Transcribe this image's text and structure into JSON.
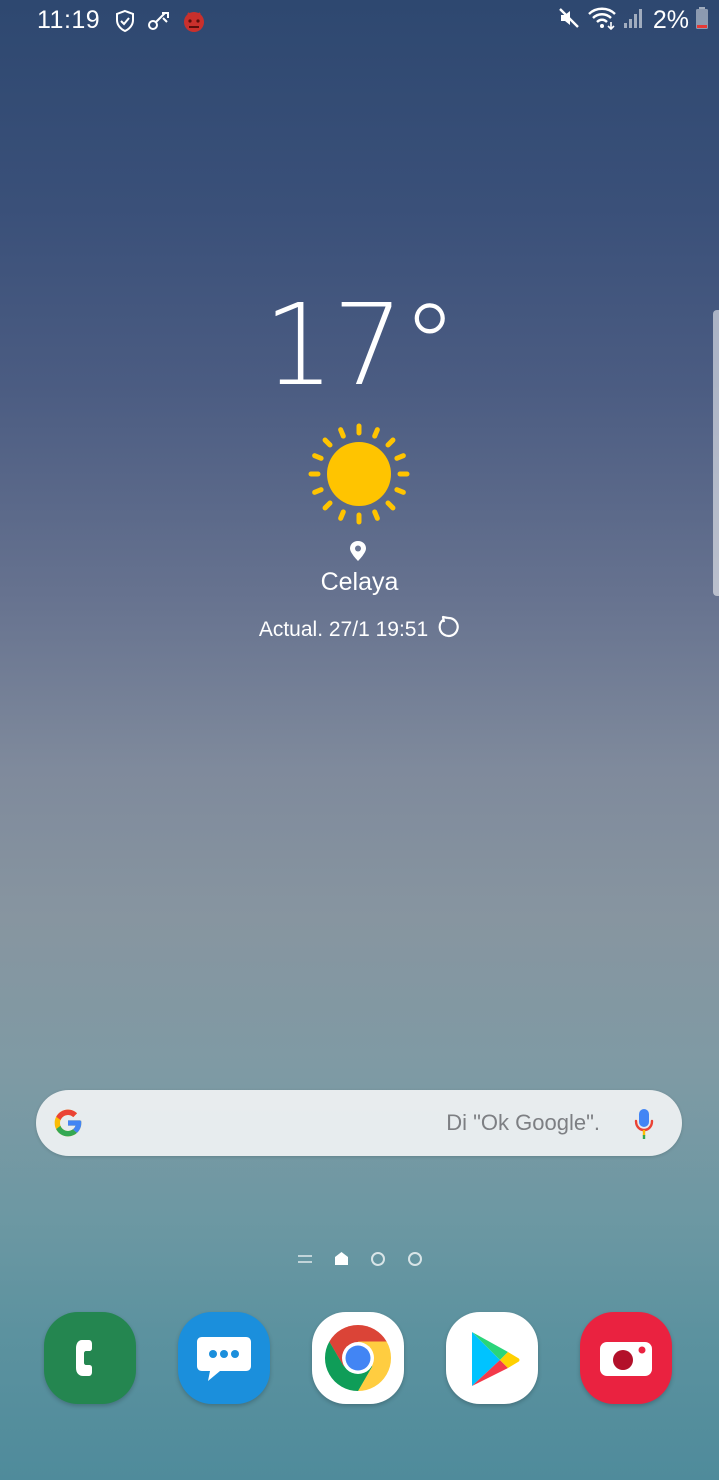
{
  "status_bar": {
    "time": "11:19",
    "battery_percent": "2%",
    "left_icons": [
      "shield-icon",
      "vpn-key-icon",
      "app-notification-icon"
    ],
    "right_icons": [
      "mute-icon",
      "wifi-icon",
      "signal-icon",
      "battery-low-icon"
    ]
  },
  "weather": {
    "temperature": "17°",
    "condition_icon": "sun-icon",
    "location": "Celaya",
    "updated": "Actual. 27/1 19:51"
  },
  "search": {
    "hint": "Di \"Ok Google\"."
  },
  "page_indicator": {
    "pages": [
      "lines",
      "home",
      "dot",
      "dot"
    ],
    "current": "home"
  },
  "dock": {
    "apps": [
      {
        "name": "Phone",
        "color": "#248650"
      },
      {
        "name": "Messages",
        "color": "#1b8fdc"
      },
      {
        "name": "Chrome",
        "color": "#ffffff"
      },
      {
        "name": "Play Store",
        "color": "#ffffff"
      },
      {
        "name": "Camera",
        "color": "#ea2240"
      }
    ]
  },
  "colors": {
    "sun": "#ffc400",
    "google_blue": "#4285f4",
    "google_red": "#ea4335",
    "google_yellow": "#fbbc05",
    "google_green": "#34a853"
  }
}
